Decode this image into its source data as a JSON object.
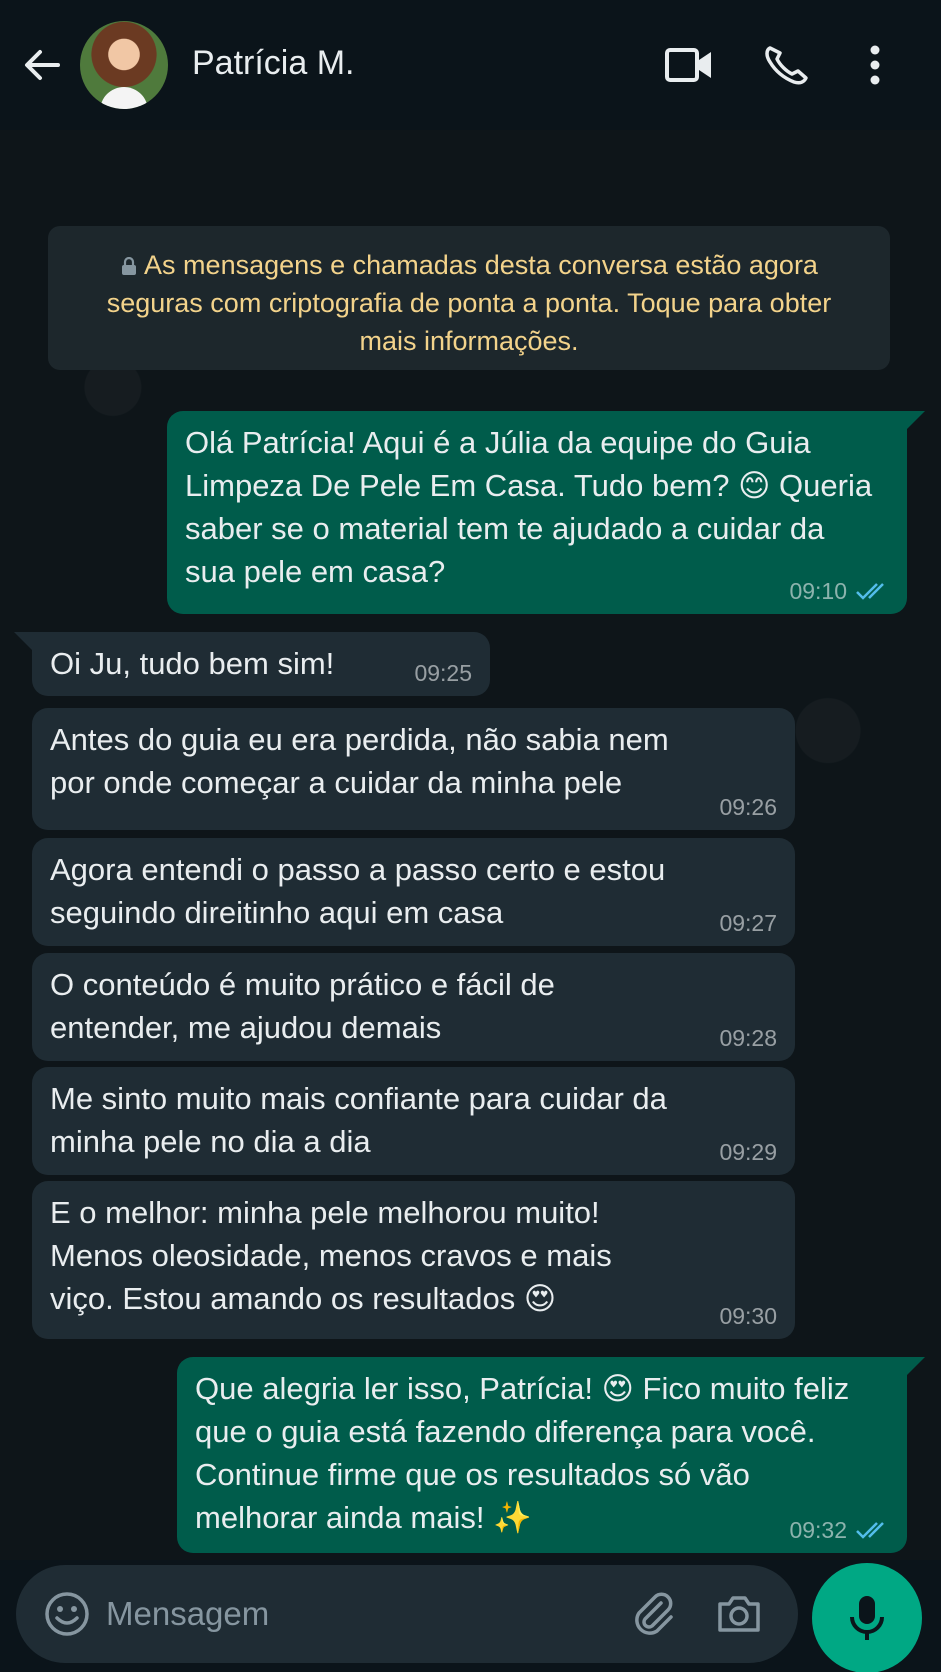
{
  "header": {
    "contact_name": "Patrícia M.",
    "icons": [
      "back-arrow-icon",
      "avatar",
      "video-call-icon",
      "phone-icon",
      "more-options-icon"
    ]
  },
  "encryption_notice": {
    "text": "As mensagens e chamadas desta conversa estão agora seguras com criptografia de ponta a ponta. Toque para obter mais informações."
  },
  "messages": [
    {
      "direction": "outgoing",
      "text": "Olá Patrícia! Aqui é a Júlia da equipe do Guia Limpeza De Pele Em Casa. Tudo bem? 😊 Queria saber se o material tem te ajudado a cuidar da sua pele em casa?",
      "time": "09:10",
      "status": "read"
    },
    {
      "direction": "incoming",
      "text": "Oi Ju, tudo bem sim!",
      "time": "09:25"
    },
    {
      "direction": "incoming",
      "text": "Antes do guia eu era perdida, não sabia nem por onde começar a cuidar da minha pele",
      "time": "09:26"
    },
    {
      "direction": "incoming",
      "text": "Agora entendi o passo a passo certo e estou seguindo direitinho aqui em casa",
      "time": "09:27"
    },
    {
      "direction": "incoming",
      "text": "O conteúdo é muito prático e fácil de entender, me ajudou demais",
      "time": "09:28"
    },
    {
      "direction": "incoming",
      "text": "Me sinto muito mais confiante para cuidar da minha pele no dia a dia",
      "time": "09:29"
    },
    {
      "direction": "incoming",
      "text": "E o melhor: minha pele melhorou muito! Menos oleosidade, menos cravos e mais viço. Estou amando os resultados 😍",
      "time": "09:30"
    },
    {
      "direction": "outgoing",
      "text": "Que alegria ler isso, Patrícia! 😍 Fico muito feliz que o guia está fazendo diferença para você. Continue firme que os resultados só vão melhorar ainda mais! ✨",
      "time": "09:32",
      "status": "read"
    }
  ],
  "composer": {
    "placeholder": "Mensagem",
    "icons": [
      "emoji-icon",
      "attach-icon",
      "camera-icon",
      "mic-icon"
    ]
  },
  "colors": {
    "background": "#0b141a",
    "outgoing_bubble": "#005c4b",
    "incoming_bubble": "#1f2c34",
    "accent": "#00a884",
    "notice_text": "#f3d38b",
    "read_ticks": "#53bdeb"
  }
}
